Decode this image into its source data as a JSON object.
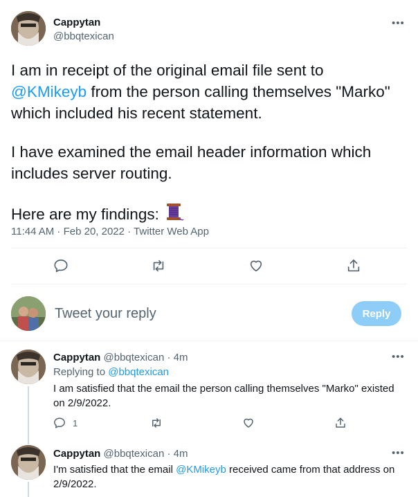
{
  "main_tweet": {
    "author_name": "Cappytan",
    "author_handle": "@bbqtexican",
    "more_icon": "more-horizontal-icon",
    "line1": "I am in receipt of the original email file sent to",
    "mention": "@KMikeyb",
    "line2_rest": " from the person calling themselves \"Marko\"",
    "line3": "which included his recent statement.",
    "para2_line1": "I have examined the email header information which",
    "para2_line2": "includes server routing.",
    "para3": "Here are my findings: ",
    "thread_emoji": "spool-of-thread-icon",
    "timestamp": "11:44 AM · Feb 20, 2022 · Twitter Web App",
    "actions": [
      "reply-icon",
      "retweet-icon",
      "like-icon",
      "share-icon"
    ]
  },
  "compose": {
    "placeholder": "Tweet your reply",
    "reply_label": "Reply"
  },
  "replies": [
    {
      "author_name": "Cappytan",
      "author_meta": "@bbqtexican · 4m",
      "replying_prefix": "Replying to ",
      "replying_to": "@bbqtexican",
      "text_line1": "I am satisfied that the email the person calling themselves \"Marko\" existed",
      "text_line2": "on 2/9/2022.",
      "reply_count": "1"
    },
    {
      "author_name": "Cappytan",
      "author_meta": "@bbqtexican · 4m",
      "text_line1_prefix": "I'm satisfied that the email ",
      "mention": "@KMikeyb",
      "text_line1_suffix": " received came from that address on",
      "text_line2": "2/9/2022."
    }
  ],
  "colors": {
    "accent": "#1d9bf0",
    "reply_button": "#8ecdf8",
    "secondary_text": "#536471"
  }
}
